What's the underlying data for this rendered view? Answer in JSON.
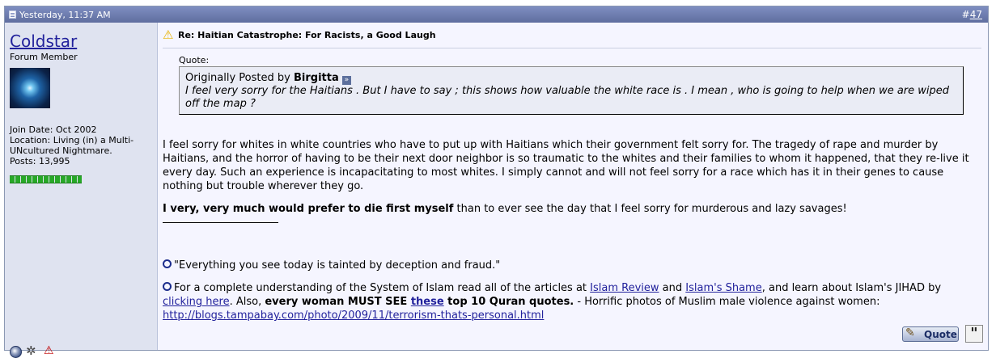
{
  "header": {
    "date": "Yesterday, 11:37 AM",
    "post_number_prefix": "#",
    "post_number": "47"
  },
  "user": {
    "name": "Coldstar",
    "title": "Forum Member",
    "join_date": "Join Date: Oct 2002",
    "location": "Location: Living (in) a Multi-UNcultured Nightmare.",
    "posts": "Posts: 13,995",
    "reputation_pips": 11
  },
  "post": {
    "title": "Re: Haitian Catastrophe: For Racists, a Good Laugh",
    "quote": {
      "label": "Quote:",
      "originally_posted_by": "Originally Posted by",
      "author": "Birgitta",
      "text": "I feel very sorry for the Haitians . But I have to say ; this shows how valuable the white race is . I mean , who is going to help when we are wiped off the map ?"
    },
    "body_p1": "I feel sorry for whites in white countries who have to put up with Haitians which their government felt sorry for. The tragedy of rape and murder by Haitians, and the horror of having to be their next door neighbor is so traumatic to the whites and their families to whom it happened, that they re-live it every day. Such an experience is incapacitating to most whites. I simply cannot and will not feel sorry for a race which has it in their genes to cause nothing but trouble wherever they go.",
    "body_p2_bold": "I very, very much would prefer to die first myself",
    "body_p2_rest": " than to ever see the day that I feel sorry for murderous and lazy savages!"
  },
  "signature": {
    "line1": "\"Everything you see today is tainted by deception and fraud.\"",
    "line2_a": "For a complete understanding of the System of Islam read all of the articles at ",
    "link_islam_review": "Islam Review",
    "line2_and": " and ",
    "link_islams_shame": "Islam's Shame",
    "line2_b": ", and learn about Islam's JIHAD by ",
    "link_clicking_here": "clicking here",
    "line2_c": ". Also, ",
    "bold_every_woman": "every woman MUST SEE ",
    "link_these": "these",
    "bold_top10": " top 10 Quran quotes.",
    "line2_d": " - Horrific photos of Muslim male violence against women:",
    "link_url": "http://blogs.tampabay.com/photo/2009/11/terrorism-thats-personal.html"
  },
  "buttons": {
    "quote": "Quote",
    "multiquote_symbol": "\""
  },
  "icons": [
    "document-icon",
    "online-status-icon",
    "profile-icon",
    "report-post-icon",
    "warning-icon",
    "view-post-icon",
    "pencil-icon"
  ],
  "colors": {
    "header_bg": "#6f7eb1",
    "sidebar_bg": "#dfe3f0",
    "link": "#22229c",
    "reputation": "#28a828"
  }
}
